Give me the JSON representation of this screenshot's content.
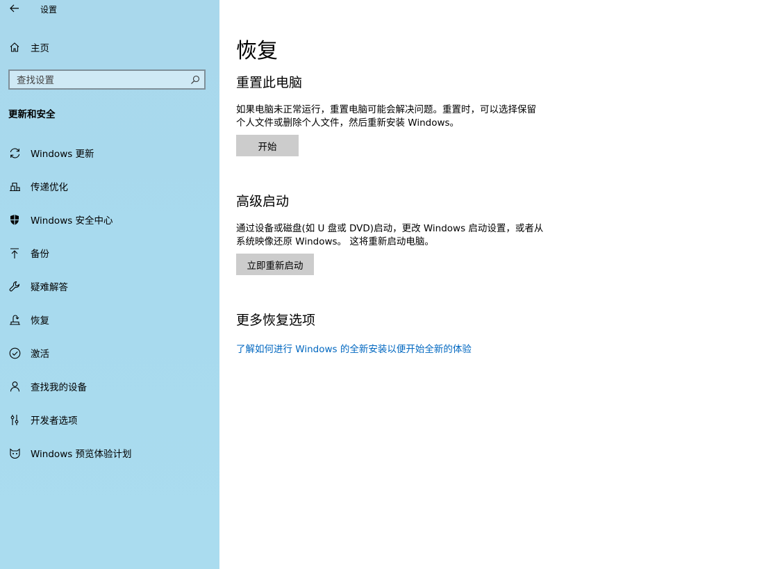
{
  "window": {
    "title": "设置"
  },
  "sidebar": {
    "home_label": "主页",
    "search_placeholder": "查找设置",
    "section_header": "更新和安全",
    "items": [
      {
        "label": "Windows 更新",
        "icon": "refresh-icon"
      },
      {
        "label": "传递优化",
        "icon": "delivery-icon"
      },
      {
        "label": "Windows 安全中心",
        "icon": "shield-icon"
      },
      {
        "label": "备份",
        "icon": "backup-arrow-icon"
      },
      {
        "label": "疑难解答",
        "icon": "wrench-icon"
      },
      {
        "label": "恢复",
        "icon": "recovery-icon"
      },
      {
        "label": "激活",
        "icon": "check-circle-icon"
      },
      {
        "label": "查找我的设备",
        "icon": "person-pin-icon"
      },
      {
        "label": "开发者选项",
        "icon": "developer-sliders-icon"
      },
      {
        "label": "Windows 预览体验计划",
        "icon": "insider-cat-icon"
      }
    ]
  },
  "main": {
    "page_title": "恢复",
    "reset": {
      "heading": "重置此电脑",
      "description_line1": "如果电脑未正常运行，重置电脑可能会解决问题。重置时，可以选择保留",
      "description_line2": "个人文件或删除个人文件，然后重新安装 Windows。",
      "button": "开始"
    },
    "advanced": {
      "heading": "高级启动",
      "description_line1": "通过设备或磁盘(如 U 盘或 DVD)启动，更改 Windows 启动设置，或者从",
      "description_line2": "系统映像还原 Windows。 这将重新启动电脑。",
      "button": "立即重新启动"
    },
    "more": {
      "heading": "更多恢复选项",
      "link": "了解如何进行 Windows 的全新安装以便开始全新的体验"
    }
  },
  "colors": {
    "sidebar_bg": "#a9d8ec",
    "link": "#0067c0",
    "button_bg": "#cccccc"
  }
}
